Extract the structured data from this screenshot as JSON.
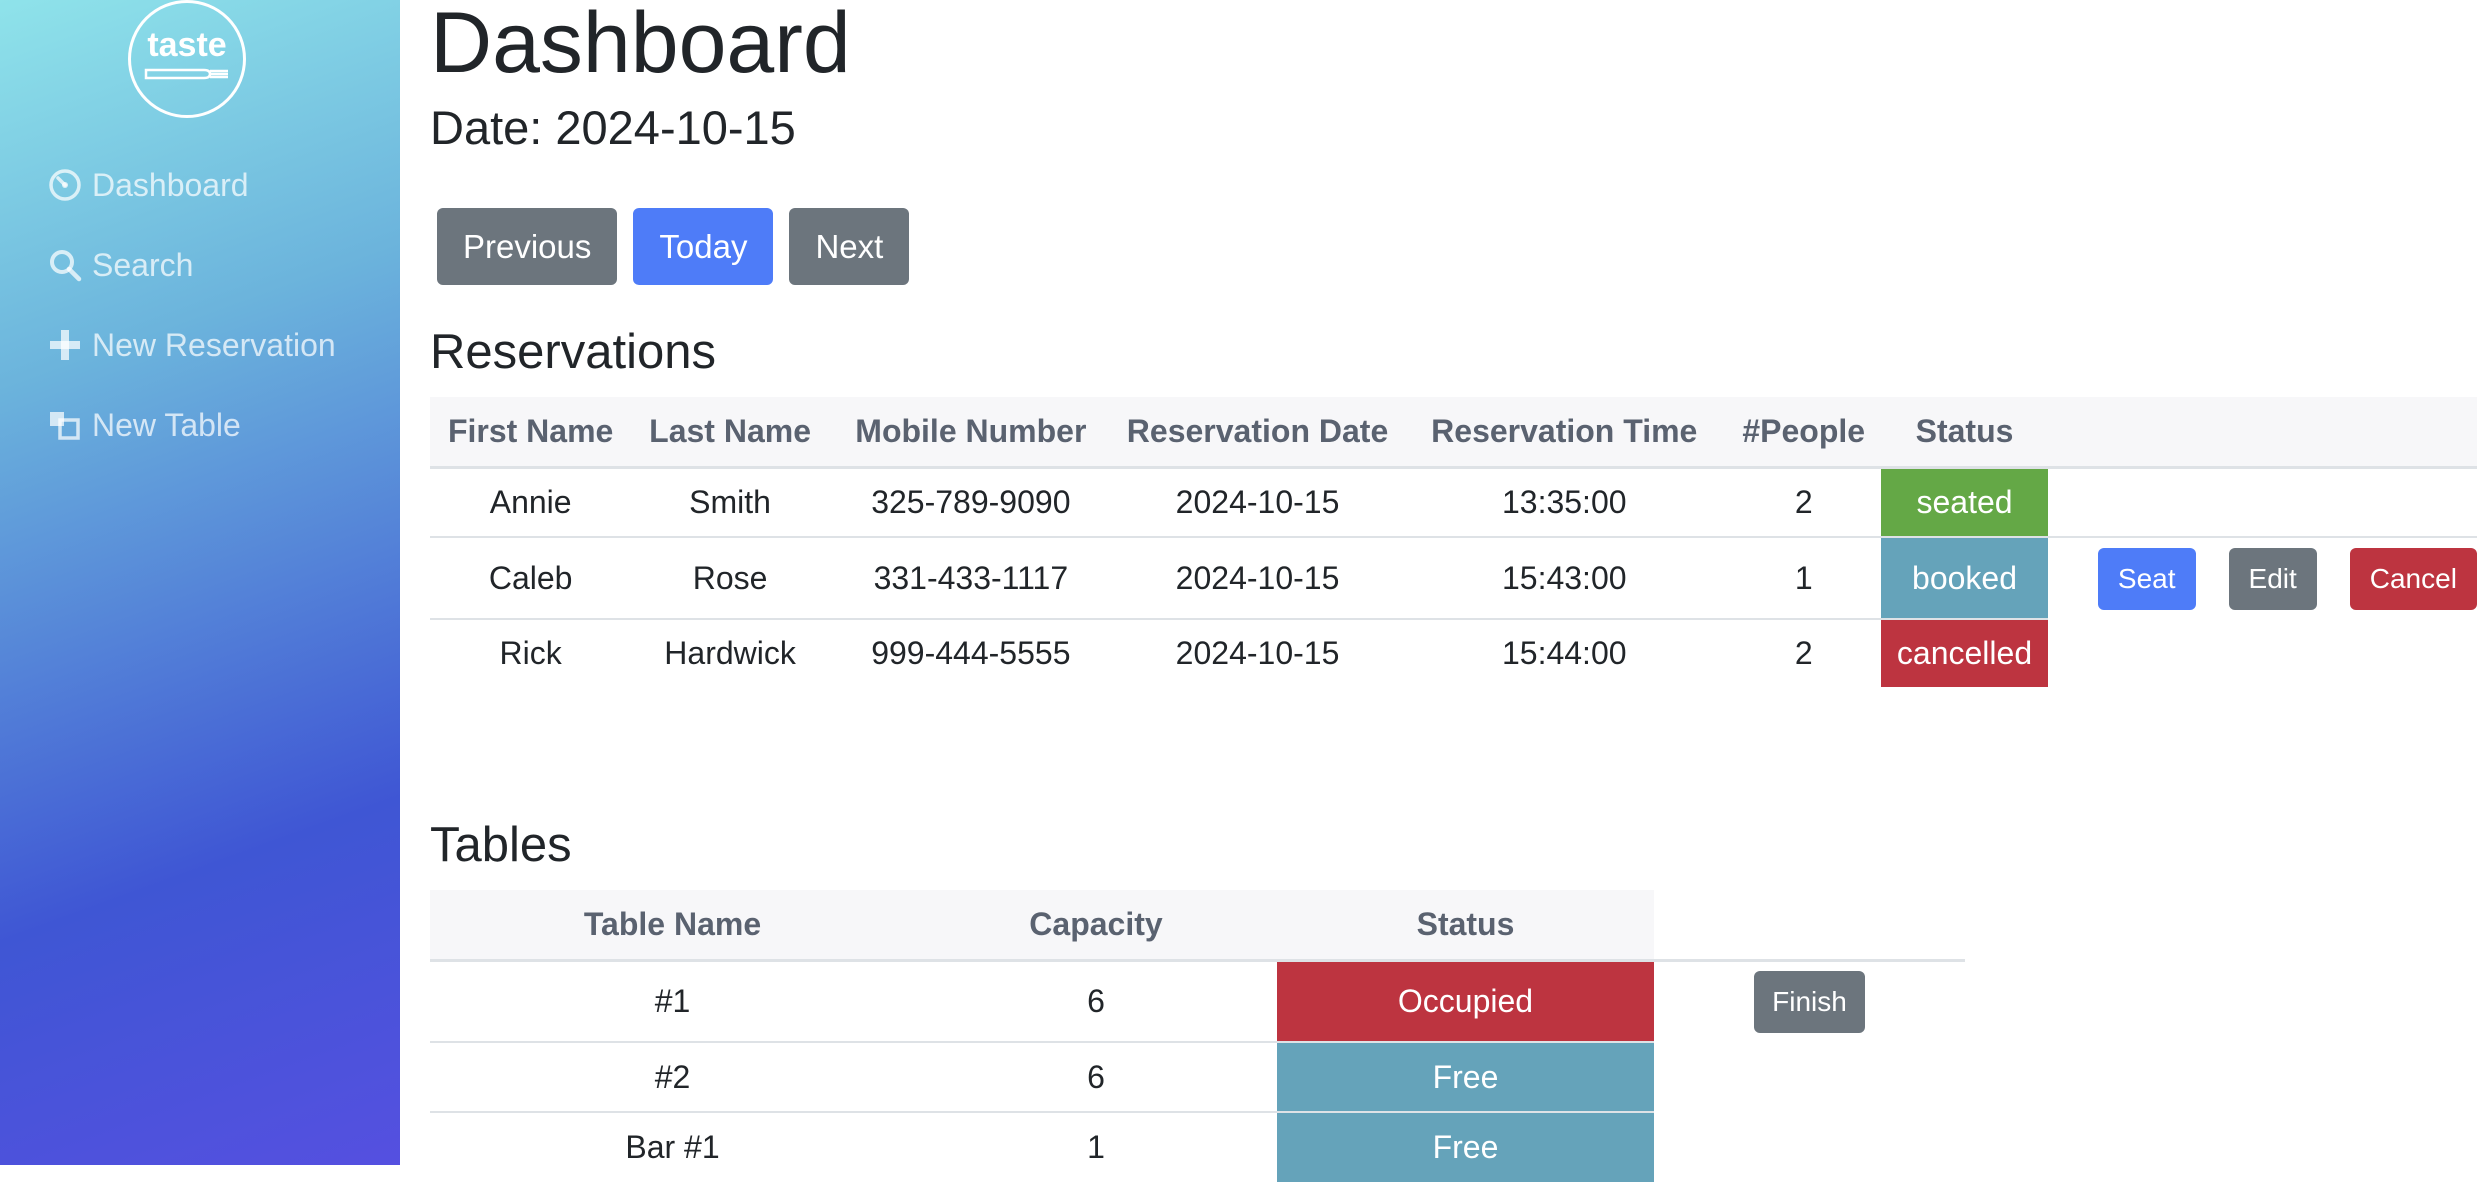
{
  "sidebar": {
    "logo_text": "taste",
    "items": [
      {
        "label": "Dashboard",
        "icon": "dashboard-icon"
      },
      {
        "label": "Search",
        "icon": "search-icon"
      },
      {
        "label": "New Reservation",
        "icon": "plus-icon"
      },
      {
        "label": "New Table",
        "icon": "table-icon"
      }
    ]
  },
  "header": {
    "title": "Dashboard",
    "date_label": "Date: 2024-10-15"
  },
  "date_nav": {
    "previous": "Previous",
    "today": "Today",
    "next": "Next"
  },
  "reservations": {
    "title": "Reservations",
    "columns": [
      "First Name",
      "Last Name",
      "Mobile Number",
      "Reservation Date",
      "Reservation Time",
      "#People",
      "Status"
    ],
    "rows": [
      {
        "first": "Annie",
        "last": "Smith",
        "mobile": "325-789-9090",
        "date": "2024-10-15",
        "time": "13:35:00",
        "people": "2",
        "status": "seated"
      },
      {
        "first": "Caleb",
        "last": "Rose",
        "mobile": "331-433-1117",
        "date": "2024-10-15",
        "time": "15:43:00",
        "people": "1",
        "status": "booked",
        "actions": {
          "seat": "Seat",
          "edit": "Edit",
          "cancel": "Cancel"
        }
      },
      {
        "first": "Rick",
        "last": "Hardwick",
        "mobile": "999-444-5555",
        "date": "2024-10-15",
        "time": "15:44:00",
        "people": "2",
        "status": "cancelled"
      }
    ]
  },
  "tables": {
    "title": "Tables",
    "columns": [
      "Table Name",
      "Capacity",
      "Status"
    ],
    "rows": [
      {
        "name": "#1",
        "capacity": "6",
        "status": "Occupied",
        "action": "Finish"
      },
      {
        "name": "#2",
        "capacity": "6",
        "status": "Free"
      },
      {
        "name": "Bar #1",
        "capacity": "1",
        "status": "Free"
      }
    ]
  },
  "colors": {
    "primary": "#4e7cf8",
    "secondary": "#6c757d",
    "danger": "#bd3440",
    "success": "#64a846",
    "info": "#65a3ba"
  }
}
